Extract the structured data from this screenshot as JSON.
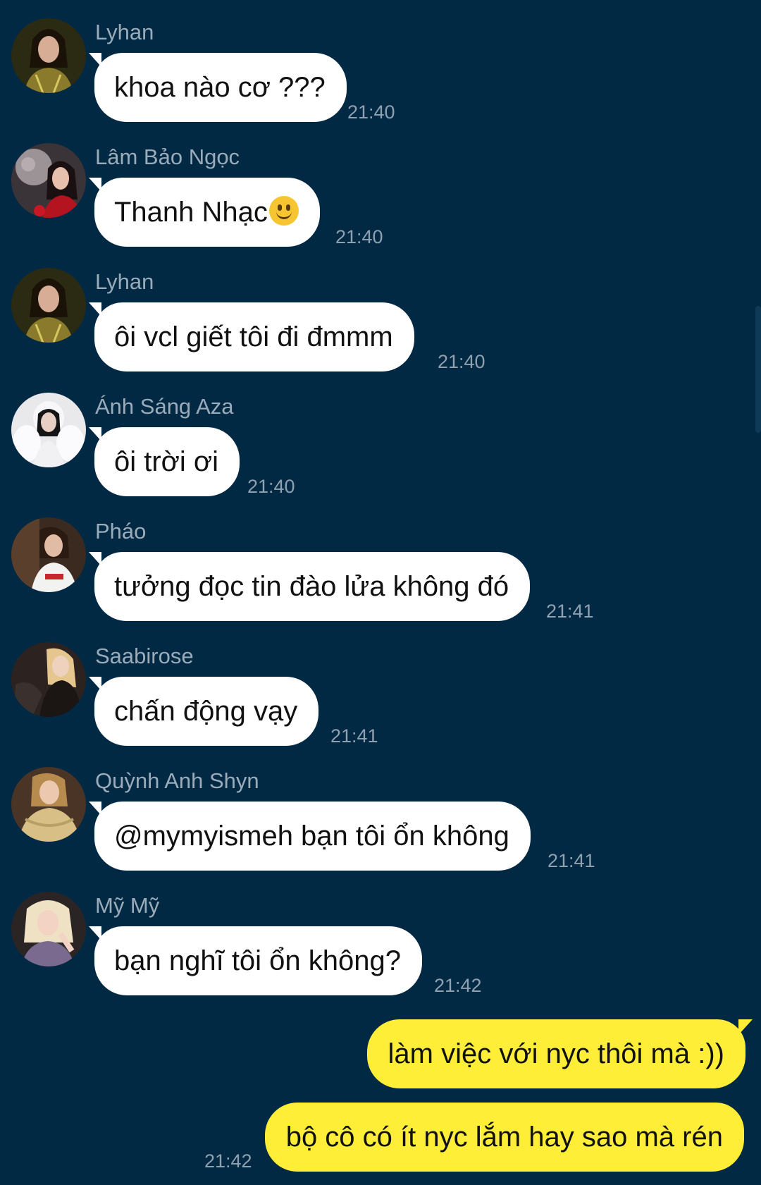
{
  "messages": [
    {
      "sender": "Lyhan",
      "text": "khoa nào cơ ???",
      "time": "21:40",
      "avatar": "avatar-lyhan"
    },
    {
      "sender": "Lâm Bảo Ngọc",
      "text": "Thanh Nhạc",
      "emoji": "slightly-smiling-face",
      "time": "21:40",
      "avatar": "avatar-lam-bao-ngoc"
    },
    {
      "sender": "Lyhan",
      "text": "ôi vcl giết tôi đi đmmm",
      "time": "21:40",
      "avatar": "avatar-lyhan"
    },
    {
      "sender": "Ánh Sáng Aza",
      "text": "ôi trời ơi",
      "time": "21:40",
      "avatar": "avatar-anh-sang-aza"
    },
    {
      "sender": "Pháo",
      "text": "tưởng đọc tin đào lửa không đó",
      "time": "21:41",
      "avatar": "avatar-phao"
    },
    {
      "sender": "Saabirose",
      "text": "chấn động vạy",
      "time": "21:41",
      "avatar": "avatar-saabirose"
    },
    {
      "sender": "Quỳnh Anh Shyn",
      "text": "@mymyismeh bạn tôi ổn không",
      "time": "21:41",
      "avatar": "avatar-quynh-anh-shyn"
    },
    {
      "sender": "Mỹ Mỹ",
      "text": "bạn nghĩ tôi ổn không?",
      "time": "21:42",
      "avatar": "avatar-my-my"
    }
  ],
  "outgoing": [
    {
      "text": "làm việc với nyc thôi mà :))"
    },
    {
      "text": "bộ cô có ít nyc lắm hay sao mà rén",
      "time": "21:42"
    }
  ],
  "colors": {
    "background": "#022944",
    "incoming_bubble": "#ffffff",
    "outgoing_bubble": "#ffee38",
    "sender_name": "#9aabb9",
    "timestamp": "#8fa1b0"
  }
}
